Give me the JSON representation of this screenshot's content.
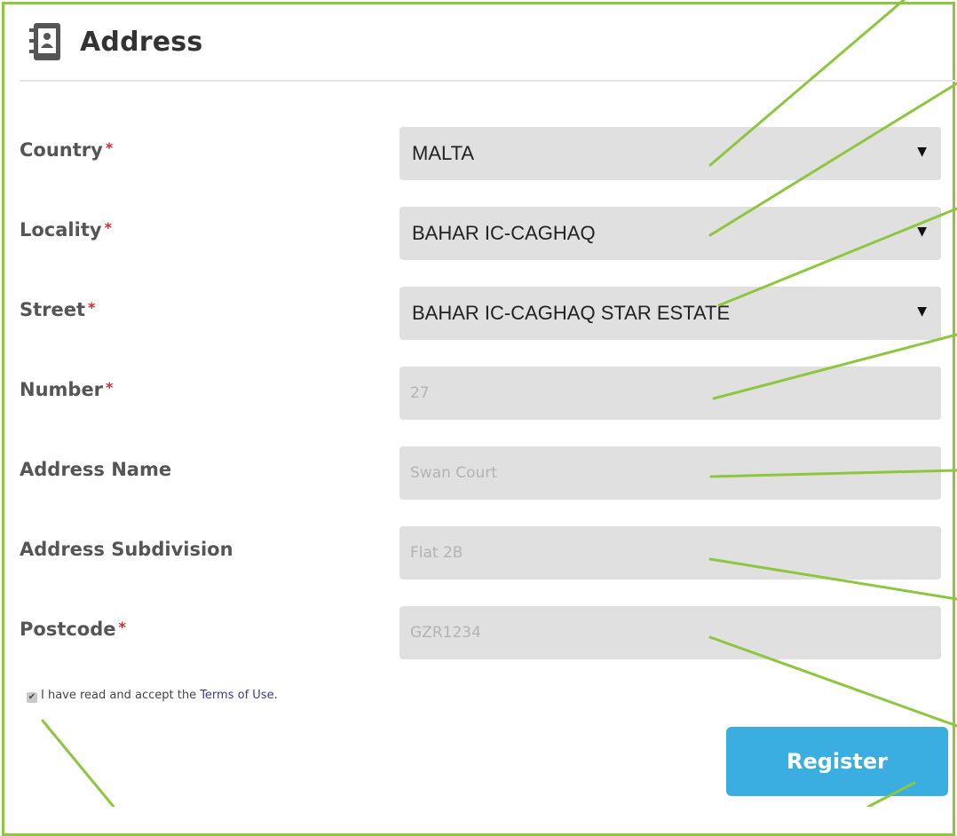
{
  "header": {
    "title": "Address",
    "icon": "contacts-book-icon"
  },
  "fields": {
    "country": {
      "label": "Country",
      "required_mark": "*",
      "value": "MALTA"
    },
    "locality": {
      "label": "Locality",
      "required_mark": "*",
      "value": "BAHAR IC-CAGHAQ"
    },
    "street": {
      "label": "Street",
      "required_mark": "*",
      "value": "BAHAR IC-CAGHAQ STAR ESTATE"
    },
    "number": {
      "label": "Number",
      "required_mark": "*",
      "placeholder": "27"
    },
    "address_name": {
      "label": "Address Name",
      "placeholder": "Swan Court"
    },
    "subdivision": {
      "label": "Address Subdivision",
      "placeholder": "Flat 2B"
    },
    "postcode": {
      "label": "Postcode",
      "required_mark": "*",
      "placeholder": "GZR1234"
    }
  },
  "terms": {
    "prefix": "I have read and accept the ",
    "link": "Terms of Use",
    "suffix": ".",
    "checked": true
  },
  "register_label": "Register",
  "colors": {
    "accent_lines": "#8dc63f",
    "button": "#3aaee0",
    "required": "#d9262f",
    "field_bg": "#e0e0e0"
  }
}
